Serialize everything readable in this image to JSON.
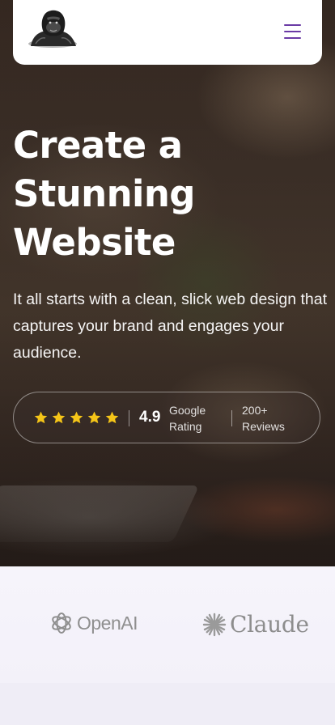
{
  "navbar": {
    "logo_icon": "gorilla-logo-icon",
    "menu_icon": "hamburger-menu-icon"
  },
  "hero": {
    "headline_lines": [
      "Create a",
      "Stunning",
      "Website"
    ],
    "subtext": "It all starts with a clean, slick web design that captures your brand and engages your audience.",
    "rating": {
      "stars": 5,
      "score": "4.9",
      "google_line1": "Google",
      "google_line2": "Rating",
      "reviews_line1": "200+",
      "reviews_line2": "Reviews"
    }
  },
  "partners": [
    {
      "name": "OpenAI",
      "icon": "openai-logo-icon"
    },
    {
      "name": "Claude",
      "icon": "claude-logo-icon"
    }
  ],
  "colors": {
    "accent": "#6a3aa5",
    "star": "#f5c518",
    "band": "#f4f2fa"
  }
}
